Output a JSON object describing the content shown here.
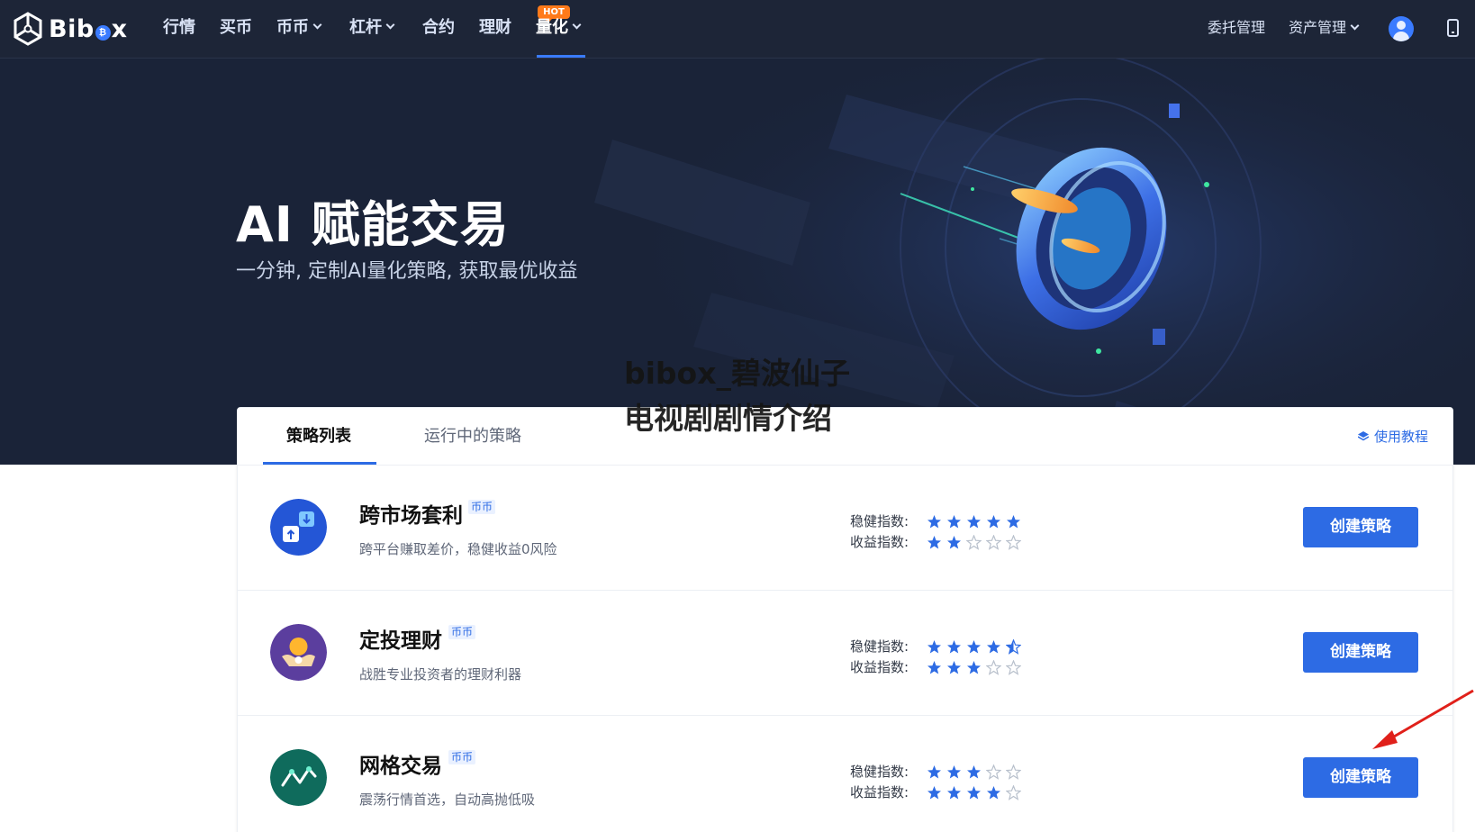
{
  "nav": {
    "logo_text": "Bibox",
    "items": [
      {
        "label": "行情",
        "has_dropdown": false
      },
      {
        "label": "买币",
        "has_dropdown": false
      },
      {
        "label": "币币",
        "has_dropdown": true
      },
      {
        "label": "杠杆",
        "has_dropdown": true
      },
      {
        "label": "合约",
        "has_dropdown": false
      },
      {
        "label": "理财",
        "has_dropdown": false
      },
      {
        "label": "量化",
        "has_dropdown": true,
        "active": true,
        "badge": "HOT"
      }
    ],
    "right": {
      "orders_label": "委托管理",
      "assets_label": "资产管理"
    },
    "accent_color": "#3a7bff",
    "badge_color": "#ff7a1a"
  },
  "hero": {
    "title": "AI 赋能交易",
    "subtitle": "一分钟, 定制AI量化策略, 获取最优收益"
  },
  "watermark": {
    "line1": "bibox_碧波仙子",
    "line2": "电视剧剧情介绍"
  },
  "tabs": {
    "items": [
      {
        "label": "策略列表",
        "active": true
      },
      {
        "label": "运行中的策略",
        "active": false
      }
    ],
    "tutorial_label": "使用教程"
  },
  "strategies": [
    {
      "name": "跨市场套利",
      "tag": "币币",
      "desc": "跨平台赚取差价，稳健收益0风险",
      "icon": "exchange-arrows-icon",
      "icon_color": "#2456d6",
      "stability_label": "稳健指数:",
      "stability_rating": 5,
      "profit_label": "收益指数:",
      "profit_rating": 2,
      "button": "创建策略"
    },
    {
      "name": "定投理财",
      "tag": "币币",
      "desc": "战胜专业投资者的理财利器",
      "icon": "coin-hand-icon",
      "icon_color": "#5b3e9e",
      "stability_label": "稳健指数:",
      "stability_rating": 4.5,
      "profit_label": "收益指数:",
      "profit_rating": 3,
      "button": "创建策略"
    },
    {
      "name": "网格交易",
      "tag": "币币",
      "desc": "震荡行情首选，自动高抛低吸",
      "icon": "zigzag-line-icon",
      "icon_color": "#0f6b5c",
      "stability_label": "稳健指数:",
      "stability_rating": 3,
      "profit_label": "收益指数:",
      "profit_rating": 4,
      "button": "创建策略"
    }
  ],
  "colors": {
    "primary_button": "#2d6be4",
    "star_filled": "#2d6be4",
    "star_empty": "#b8c0cc",
    "nav_bg": "#1d2537",
    "hero_bg": "#1a2338",
    "annotation_arrow": "#e0201a"
  }
}
